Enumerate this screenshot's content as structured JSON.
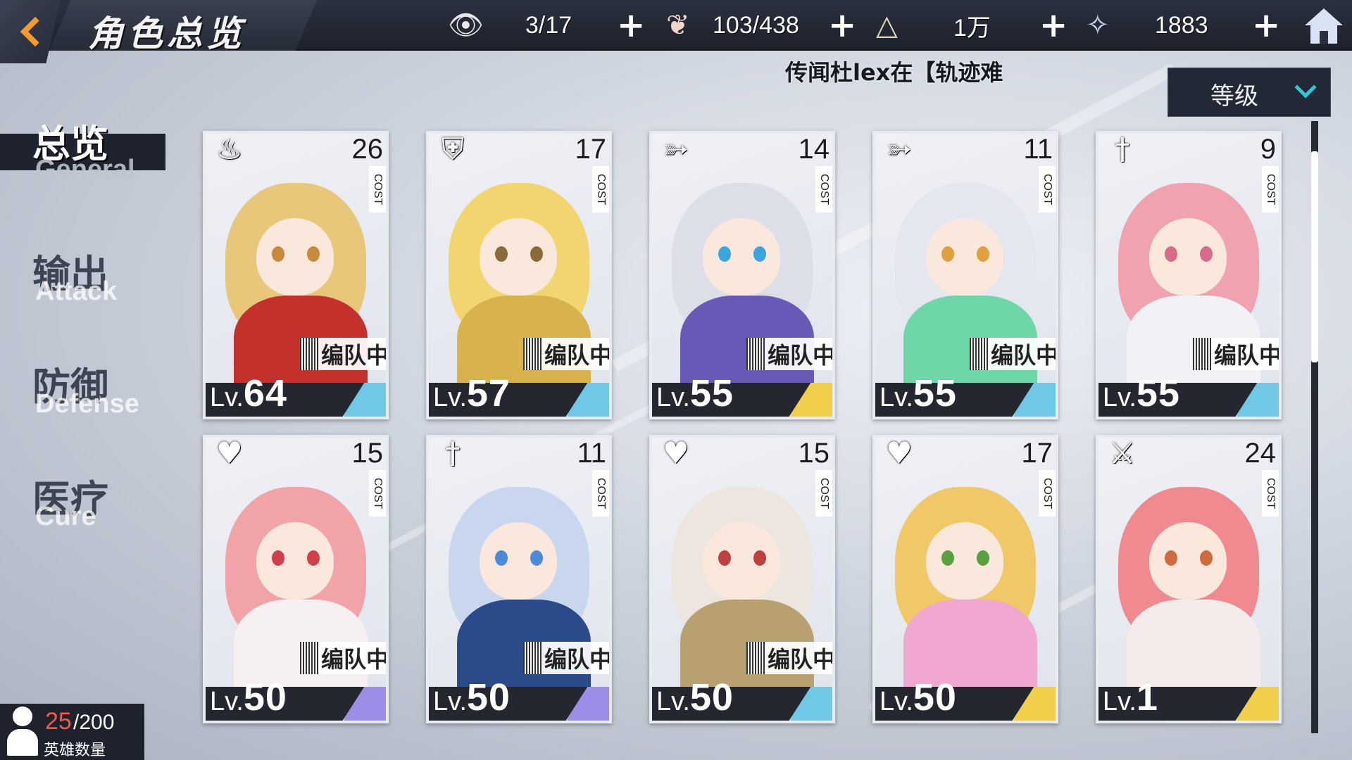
{
  "header": {
    "title": "角色总览",
    "resources": [
      {
        "icon": "eye-icon",
        "value": "3/17"
      },
      {
        "icon": "stamina-icon",
        "value": "103/438"
      },
      {
        "icon": "pyramid-icon",
        "value": "1万"
      },
      {
        "icon": "star-crystal-icon",
        "value": "1883"
      }
    ]
  },
  "ticker": "传闻杜lex在【轨迹难",
  "sort": {
    "selected": "等级"
  },
  "categories": [
    {
      "cn": "总览",
      "en": "General",
      "active": true
    },
    {
      "cn": "输出",
      "en": "Attack",
      "active": false
    },
    {
      "cn": "防御",
      "en": "Defense",
      "active": false
    },
    {
      "cn": "医疗",
      "en": "Cure",
      "active": false
    }
  ],
  "cost_label": "COST",
  "lv_prefix": "Lv.",
  "team_label": "编队中",
  "heroes": [
    {
      "class_icon": "flame-icon",
      "cost": "26",
      "level": "64",
      "in_team": true,
      "stripe": "#6ec8e6",
      "hair": "#e9c77a",
      "outfit": "#c4302b",
      "eye": "#c78a3a"
    },
    {
      "class_icon": "shield-icon",
      "cost": "17",
      "level": "57",
      "in_team": true,
      "stripe": "#6ec8e6",
      "hair": "#f2d56e",
      "outfit": "#d8b24a",
      "eye": "#8a6a3a"
    },
    {
      "class_icon": "bow-icon",
      "cost": "14",
      "level": "55",
      "in_team": true,
      "stripe": "#f2cf4a",
      "hair": "#dcdee8",
      "outfit": "#6a5ab8",
      "eye": "#3aa6e0"
    },
    {
      "class_icon": "bow-icon",
      "cost": "11",
      "level": "55",
      "in_team": true,
      "stripe": "#6ec8e6",
      "hair": "#e4e6f0",
      "outfit": "#6fd6a8",
      "eye": "#e0a040"
    },
    {
      "class_icon": "sword-icon",
      "cost": "9",
      "level": "55",
      "in_team": true,
      "stripe": "#6ec8e6",
      "hair": "#f0a3ae",
      "outfit": "#f2f2f6",
      "eye": "#d86a8a"
    },
    {
      "class_icon": "heart-wing-icon",
      "cost": "15",
      "level": "50",
      "in_team": true,
      "stripe": "#9c8ee6",
      "hair": "#f2a3a8",
      "outfit": "#f6f0f0",
      "eye": "#d04048"
    },
    {
      "class_icon": "sword-icon",
      "cost": "11",
      "level": "50",
      "in_team": true,
      "stripe": "#9c8ee6",
      "hair": "#c8d6ee",
      "outfit": "#2a4a8a",
      "eye": "#4a8ad8"
    },
    {
      "class_icon": "heart-wing-icon",
      "cost": "15",
      "level": "50",
      "in_team": true,
      "stripe": "#6ec8e6",
      "hair": "#ece6de",
      "outfit": "#b8a070",
      "eye": "#c04040"
    },
    {
      "class_icon": "heart-wing-icon",
      "cost": "17",
      "level": "50",
      "in_team": false,
      "stripe": "#f2cf4a",
      "hair": "#f0c868",
      "outfit": "#f0a8d0",
      "eye": "#5aa040"
    },
    {
      "class_icon": "winged-sword-icon",
      "cost": "24",
      "level": "1",
      "in_team": false,
      "stripe": "#f2cf4a",
      "hair": "#f08a90",
      "outfit": "#f4ecea",
      "eye": "#d06a40"
    }
  ],
  "hero_count": {
    "current": "25",
    "max": "/200",
    "label": "英雄数量"
  }
}
